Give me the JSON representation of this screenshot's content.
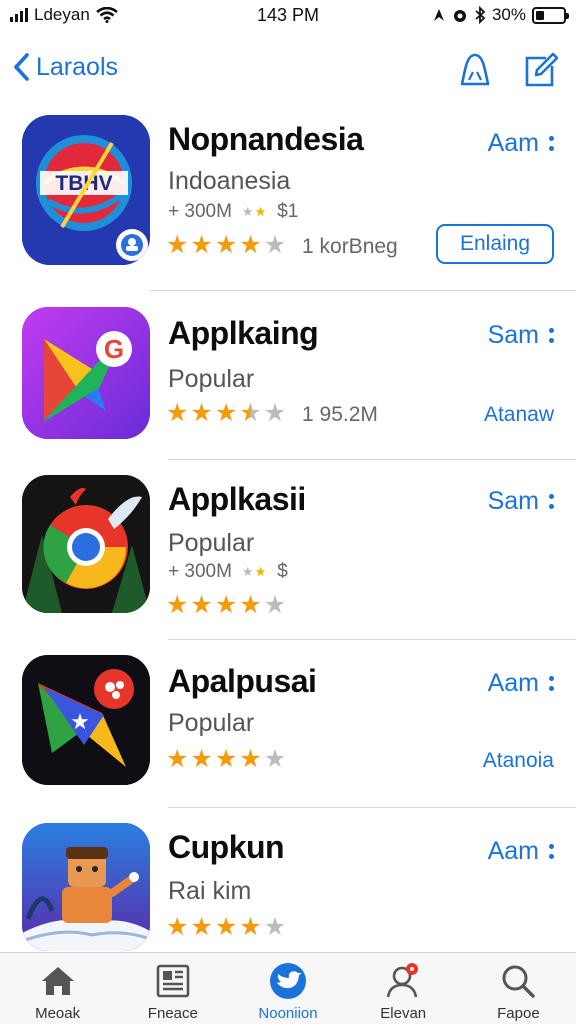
{
  "status_bar": {
    "carrier": "Ldeyan",
    "time": "143 PM",
    "battery": "30%",
    "battery_level": 0.3
  },
  "nav": {
    "back_label": "Laraols",
    "icons": [
      "bell-icon",
      "compose-icon"
    ]
  },
  "colors": {
    "accent": "#1a73d9",
    "star": "#f49b0b",
    "divider": "#d8d8d8"
  },
  "apps": [
    {
      "name": "Nopnandesia",
      "subtitle": "Indoanesia",
      "meta_size": "+ 300M",
      "meta_price": "$1",
      "rating": 4,
      "rating_text": "1 korBneg",
      "action": "Aam",
      "button": "Enlaing",
      "icon": "tv-globe-icon"
    },
    {
      "name": "Applkaing",
      "subtitle": "Popular",
      "rating": 3.5,
      "rating_text": "1 95.2M",
      "action": "Sam",
      "secondary": "Atanaw",
      "icon": "maps-pin-icon"
    },
    {
      "name": "Applkasii",
      "subtitle": "Popular",
      "meta_size": "+ 300M",
      "meta_price": "$",
      "rating": 4,
      "action": "Sam",
      "icon": "chrome-bird-icon"
    },
    {
      "name": "Apalpusai",
      "subtitle": "Popular",
      "rating": 4,
      "action": "Aam",
      "secondary": "Atanoia",
      "icon": "star-cone-icon"
    },
    {
      "name": "Cupkun",
      "subtitle": "Rai kim",
      "rating": 4,
      "action": "Aam",
      "icon": "game-character-icon"
    }
  ],
  "tabs": [
    {
      "label": "Meoak",
      "icon": "home-icon",
      "active": false
    },
    {
      "label": "Fneace",
      "icon": "news-icon",
      "active": false
    },
    {
      "label": "Nooniion",
      "icon": "bird-icon",
      "active": true
    },
    {
      "label": "Elevan",
      "icon": "profile-icon",
      "active": false
    },
    {
      "label": "Fapoe",
      "icon": "search-icon",
      "active": false
    }
  ]
}
